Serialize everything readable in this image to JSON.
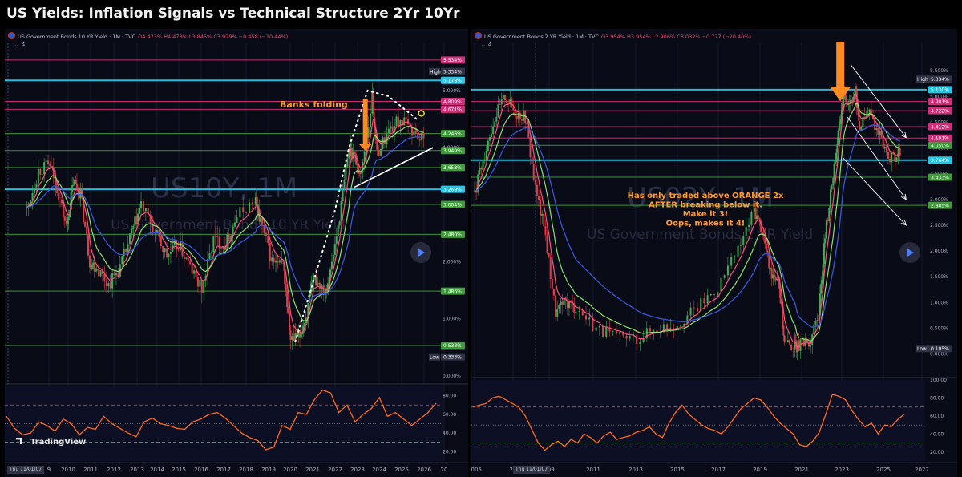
{
  "page_title": "US Yields: Inflation Signals vs Technical Structure 2Yr 10Yr",
  "brand": "TradingView",
  "colors": {
    "background": "#090b16",
    "cyan": "#29c5e6",
    "magenta": "#d02f7a",
    "green": "#3f9a3a",
    "orange": "#ff7a1a",
    "price": "#e74c4c",
    "ma_fast": "#ff4f7a",
    "ma_mid": "#8ee06a",
    "ma_slow": "#3a56d8",
    "rsi": "#ff6a1a"
  },
  "panels": [
    {
      "id": "us10y",
      "symbol_header": "US Government Bonds 10 YR Yield · 1M · TVC",
      "ohlc": "O4.473% H4.473% L3.845% C3.929% −0.458 (−10.44%)",
      "indicator_count": "4",
      "watermark_symbol": "US10Y, 1M",
      "watermark_name": "US Government Bonds 10 YR Yield",
      "annotation": "Banks folding",
      "date_badge": "Thu 11/01/07",
      "x_labels": [
        "9",
        "2010",
        "2011",
        "2012",
        "2013",
        "2014",
        "2015",
        "2016",
        "2017",
        "2018",
        "2019",
        "2020",
        "2021",
        "2022",
        "2023",
        "2024",
        "2025",
        "2026",
        "20"
      ],
      "y_labels": [
        "5.000%",
        "4.000%",
        "3.000%",
        "2.000%",
        "1.000%",
        "0.000%"
      ],
      "level_badges": [
        "5.534%",
        "5.334%",
        "5.178%",
        "4.809%",
        "4.672%",
        "4.671%",
        "4.246%",
        "3.949%",
        "3.653%",
        "3.269%",
        "3.004%",
        "2.480%",
        "1.486%",
        "0.533%",
        "0.333%"
      ],
      "high_label": "High",
      "low_label": "Low",
      "rsi_labels": [
        "80.00",
        "60.00",
        "40.00",
        "20.00"
      ]
    },
    {
      "id": "us02y",
      "symbol_header": "US Government Bonds 2 YR Yield · 1M · TVC",
      "ohlc": "O3.954% H3.954% L2.906% C3.032% −0.777 (−20.40%)",
      "indicator_count": "4",
      "watermark_symbol": "US02Y, 1M",
      "watermark_name": "US Government Bonds 2 YR Yield",
      "annotation": [
        "Has only traded above ORANGE 2x",
        "AFTER breaking below it.",
        "Make it 3!",
        "Oops, makes it 4!"
      ],
      "date_badge": "Thu 11/01/07",
      "x_labels": [
        "2005",
        "20",
        "009",
        "2011",
        "2013",
        "2015",
        "2017",
        "2019",
        "2021",
        "2023",
        "2025",
        "2027"
      ],
      "y_labels": [
        "5.500%",
        "5.000%",
        "4.500%",
        "4.000%",
        "3.500%",
        "3.000%",
        "2.500%",
        "2.000%",
        "1.500%",
        "1.000%",
        "0.500%",
        "0.000%"
      ],
      "level_badges": [
        "5.334%",
        "5.130%",
        "4.901%",
        "4.722%",
        "4.412%",
        "4.191%",
        "4.050%",
        "3.764%",
        "3.433%",
        "2.885%",
        "0.105%"
      ],
      "high_label": "High",
      "low_label": "Low",
      "rsi_labels": [
        "100.00",
        "80.00",
        "60.00",
        "40.00",
        "20.00"
      ]
    }
  ],
  "chart_data": [
    {
      "type": "line",
      "x": [
        2009,
        2009.5,
        2010,
        2010.3,
        2010.7,
        2011,
        2011.3,
        2011.7,
        2012,
        2012.5,
        2013,
        2013.5,
        2013.9,
        2014.5,
        2015,
        2015.5,
        2016,
        2016.5,
        2017,
        2017.5,
        2018,
        2018.8,
        2019,
        2019.5,
        2020,
        2020.3,
        2020.7,
        2021,
        2021.3,
        2021.8,
        2022,
        2022.4,
        2022.8,
        2023,
        2023.3,
        2023.8,
        2024,
        2024.5,
        2025,
        2025.5,
        2026
      ],
      "series": [
        {
          "values": [
            2.9,
            3.6,
            3.7,
            3.3,
            2.6,
            3.4,
            3.2,
            2.0,
            1.9,
            1.6,
            1.9,
            2.5,
            3.0,
            2.5,
            2.1,
            2.3,
            1.9,
            1.5,
            2.4,
            2.3,
            2.8,
            3.1,
            2.7,
            2.0,
            1.9,
            0.6,
            0.7,
            1.1,
            1.7,
            1.5,
            1.8,
            2.8,
            4.0,
            3.9,
            3.5,
            4.9,
            3.9,
            4.3,
            4.5,
            4.3,
            4.1
          ]
        }
      ],
      "y_unit": "%",
      "ylim": [
        -0.1,
        5.8
      ],
      "high": 5.334,
      "low": 0.333,
      "horizontal_levels": [
        {
          "value": 5.534,
          "color": "magenta"
        },
        {
          "value": 5.178,
          "color": "cyan"
        },
        {
          "value": 4.809,
          "color": "magenta"
        },
        {
          "value": 4.671,
          "color": "magenta"
        },
        {
          "value": 4.246,
          "color": "green"
        },
        {
          "value": 3.949,
          "color": "green"
        },
        {
          "value": 3.653,
          "color": "green"
        },
        {
          "value": 3.269,
          "color": "cyan"
        },
        {
          "value": 3.004,
          "color": "green"
        },
        {
          "value": 2.48,
          "color": "green"
        },
        {
          "value": 1.486,
          "color": "green"
        },
        {
          "value": 0.533,
          "color": "green"
        }
      ],
      "rsi": {
        "ylim": [
          10,
          90
        ],
        "levels": [
          70,
          50,
          30
        ],
        "values": [
          58,
          45,
          38,
          40,
          52,
          48,
          42,
          55,
          50,
          38,
          46,
          44,
          58,
          50,
          45,
          40,
          36,
          52,
          56,
          50,
          48,
          45,
          44,
          52,
          55,
          60,
          62,
          56,
          48,
          40,
          35,
          32,
          22,
          25,
          48,
          44,
          62,
          60,
          76,
          86,
          83,
          62,
          70,
          52,
          60,
          66,
          78,
          58,
          62,
          55,
          48,
          55,
          62,
          72
        ]
      }
    },
    {
      "type": "line",
      "x": [
        2005,
        2005.5,
        2006,
        2006.5,
        2007,
        2007.5,
        2008,
        2008.5,
        2009,
        2009.5,
        2010,
        2011,
        2012,
        2013,
        2014,
        2015,
        2016,
        2017,
        2018,
        2018.8,
        2019.2,
        2019.6,
        2020,
        2020.3,
        2020.8,
        2021,
        2021.5,
        2022,
        2022.3,
        2022.7,
        2023,
        2023.2,
        2023.5,
        2023.8,
        2024,
        2024.5,
        2025,
        2025.5,
        2026
      ],
      "series": [
        {
          "values": [
            3.1,
            3.9,
            4.6,
            5.0,
            4.7,
            4.6,
            3.2,
            2.3,
            0.8,
            1.0,
            0.9,
            0.5,
            0.3,
            0.3,
            0.5,
            0.6,
            0.9,
            1.3,
            2.0,
            2.8,
            2.4,
            1.6,
            1.5,
            0.2,
            0.15,
            0.15,
            0.2,
            0.8,
            2.3,
            3.5,
            4.4,
            5.0,
            4.9,
            5.1,
            4.4,
            4.7,
            4.2,
            3.8,
            3.9
          ]
        }
      ],
      "y_unit": "%",
      "ylim": [
        -0.1,
        6.0
      ],
      "high": 5.334,
      "low": 0.105,
      "horizontal_levels": [
        {
          "value": 5.13,
          "color": "cyan"
        },
        {
          "value": 4.901,
          "color": "magenta"
        },
        {
          "value": 4.722,
          "color": "magenta"
        },
        {
          "value": 4.412,
          "color": "magenta"
        },
        {
          "value": 4.191,
          "color": "magenta"
        },
        {
          "value": 4.05,
          "color": "green"
        },
        {
          "value": 3.764,
          "color": "cyan"
        },
        {
          "value": 3.433,
          "color": "green"
        },
        {
          "value": 2.885,
          "color": "green"
        }
      ],
      "rsi": {
        "ylim": [
          10,
          100
        ],
        "levels": [
          70,
          50,
          30
        ],
        "values": [
          70,
          72,
          74,
          80,
          82,
          78,
          74,
          70,
          60,
          45,
          30,
          22,
          28,
          32,
          26,
          34,
          30,
          40,
          36,
          30,
          38,
          42,
          34,
          36,
          38,
          42,
          44,
          48,
          40,
          36,
          52,
          64,
          72,
          62,
          56,
          50,
          46,
          44,
          40,
          48,
          58,
          68,
          74,
          80,
          78,
          70,
          60,
          52,
          46,
          40,
          28,
          26,
          32,
          42,
          62,
          84,
          82,
          78,
          66,
          56,
          48,
          52,
          40,
          50,
          48,
          56,
          62
        ]
      }
    }
  ]
}
